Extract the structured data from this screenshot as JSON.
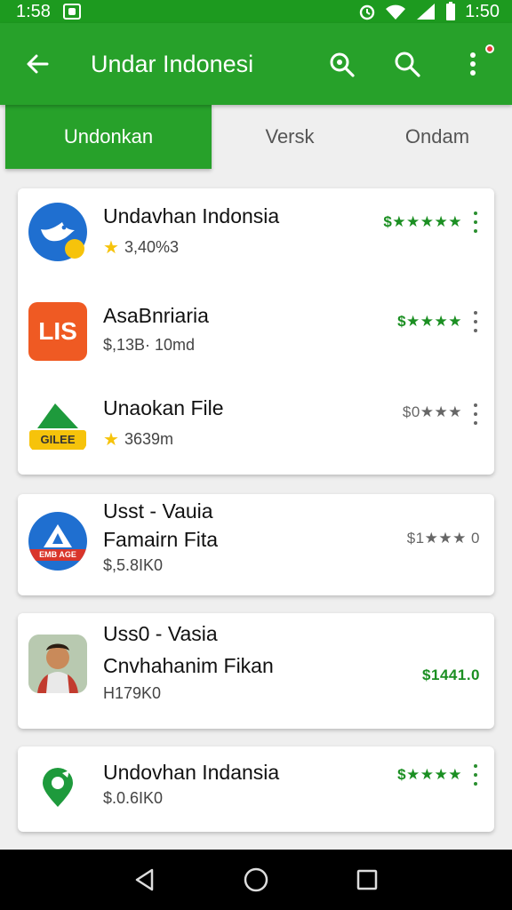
{
  "status_bar": {
    "time_left": "1:58",
    "time_right": "1:50"
  },
  "app_bar": {
    "title": "Undar Indonesi"
  },
  "tabs": [
    {
      "label": "Undonkan",
      "active": true
    },
    {
      "label": "Versk",
      "active": false
    },
    {
      "label": "Ondam",
      "active": false
    }
  ],
  "cards": [
    {
      "items": [
        {
          "name": "Undavhan Indonsia",
          "meta": "3,40%3",
          "has_star": true,
          "rating": "$★★★★★",
          "icon": "bird-logo-icon"
        },
        {
          "name": "AsaBnriaria",
          "meta": "$,13B· 10md",
          "has_star": false,
          "rating": "$★★★★",
          "icon": "lis-logo-icon",
          "icon_text": "LIS"
        },
        {
          "name": "Unaokan File",
          "meta": "3639m",
          "has_star": true,
          "rating": "$0★★★",
          "icon": "gilee-logo-icon",
          "icon_text": "GILEE"
        }
      ]
    },
    {
      "items": [
        {
          "name_line1": "Usst - Vauia",
          "name_line2": "Famairn Fita",
          "meta": "$,5.8IK0",
          "rating": "$1★★★ 0",
          "icon": "triangle-logo-icon",
          "icon_text": "EMB AGE"
        }
      ]
    },
    {
      "items": [
        {
          "name_line1": "Uss0 - Vasia",
          "name_line2": "Cnvhahanim Fikan",
          "meta": "H179K0",
          "rating": "$1441.0",
          "icon": "person-photo-icon"
        }
      ]
    },
    {
      "items": [
        {
          "name": "Undovhan Indansia",
          "meta": "$.0.6IK0",
          "rating": "$★★★★",
          "icon": "green-pin-logo-icon"
        }
      ]
    }
  ],
  "colors": {
    "primary": "#27a12a",
    "status_bar": "#1d9a1f",
    "rating_green": "#1b8f22",
    "star": "#f6c30b"
  }
}
